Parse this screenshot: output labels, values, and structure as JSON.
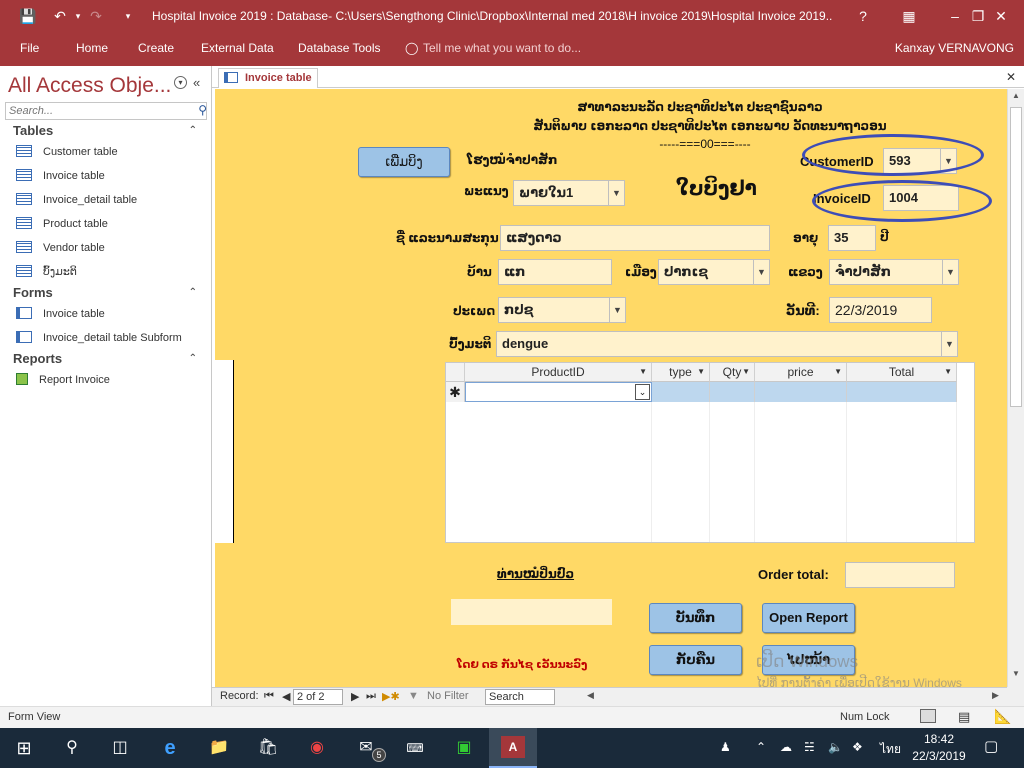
{
  "titlebar": {
    "title": "Hospital Invoice 2019 : Database- C:\\Users\\Sengthong Clinic\\Dropbox\\Internal med 2018\\H invoice 2019\\Hospital Invoice 2019...",
    "help": "?"
  },
  "ribbon": {
    "tabs": [
      "File",
      "Home",
      "Create",
      "External Data",
      "Database Tools"
    ],
    "tell_me": "Tell me what you want to do...",
    "user": "Kanxay VERNAVONG"
  },
  "nav": {
    "title": "All Access Obje...",
    "search_placeholder": "Search...",
    "groups": {
      "tables": "Tables",
      "forms": "Forms",
      "reports": "Reports"
    },
    "tables": [
      "Customer table",
      "Invoice table",
      "Invoice_detail table",
      "Product table",
      "Vendor table",
      "ບົ້ງມະຕິ"
    ],
    "forms": [
      "Invoice table",
      "Invoice_detail table Subform"
    ],
    "reports": [
      "Report Invoice"
    ]
  },
  "doc_tab": {
    "label": "Invoice table"
  },
  "form": {
    "header_line1": "ສາທາລະນະລັດ ປະຊາທິປະໄຕ ປະຊາຊົນລາວ",
    "header_line2": "ສັນຕິພາບ ເອກະລາດ ປະຊາທິປະໄຕ ເອກະພາບ ວັດທະນາຖາວອນ",
    "header_line3": "-----===00===----",
    "add_button": "ເພີ່ມບິງ",
    "hospital_label": "ໂຮງໝໍຈຳປາສັກ",
    "department_label": "ພະແນງ",
    "department_value": "ພາຍໃນ1",
    "form_title": "ໃບບິງຢາ",
    "customer_id_label": "CustomerID",
    "customer_id_value": "593",
    "invoice_id_label": "InvoiceID",
    "invoice_id_value": "1004",
    "name_label": "ຊື່ ແລະນາມສະກຸນ",
    "name_value": "ແສງດາວ",
    "age_label": "ອາຍຸ",
    "age_value": "35",
    "age_unit": "ປີ",
    "village_label": "ບ້ານ",
    "village_value": "ແກ",
    "district_label": "ເມືອງ",
    "district_value": "ປາກເຊ",
    "province_label": "ແຂວງ",
    "province_value": "ຈຳປາສັກ",
    "type_label": "ປະເພດ",
    "type_value": "ກປຊ",
    "date_label": "ວັນທີ:",
    "date_value": "22/3/2019",
    "diagnosis_label": "ບົ້ງມະຕິ",
    "diagnosis_value": "dengue",
    "subform_columns": [
      "ProductID",
      "type",
      "Qty",
      "price",
      "Total"
    ],
    "doctor_label": "ທ່ານໝໍປິ່ນປົວ",
    "order_total_label": "Order total:",
    "save_button": "ບັນທຶກ",
    "open_report_button": "Open Report",
    "undo_button": "ກັບຄືນ",
    "next_button": "ໄປໜ້າ",
    "credit_text": "ໂດຍ ດຣ ກັນໄຊ ເວັນນະວົງ"
  },
  "recnav": {
    "record_label": "Record:",
    "position": "2 of 2",
    "filter": "No Filter",
    "search": "Search"
  },
  "status": {
    "view": "Form View",
    "numlock": "Num Lock"
  },
  "watermark": {
    "line1": "ເປີດ Windows",
    "line2": "ໄປທີ່ ການຕັ້ງຄ່າ ເພື່ອເປີດໃຊ້ງານ Windows"
  },
  "taskbar": {
    "mail_badge": "5",
    "lang": "ไทย",
    "time": "18:42",
    "date": "22/3/2019"
  },
  "colors": {
    "access_red": "#a4373a",
    "form_bg": "#ffd966",
    "field_bg": "#fff2cc",
    "button_blue": "#9dc3e6",
    "annotation_ellipse": "#3d4db7"
  }
}
